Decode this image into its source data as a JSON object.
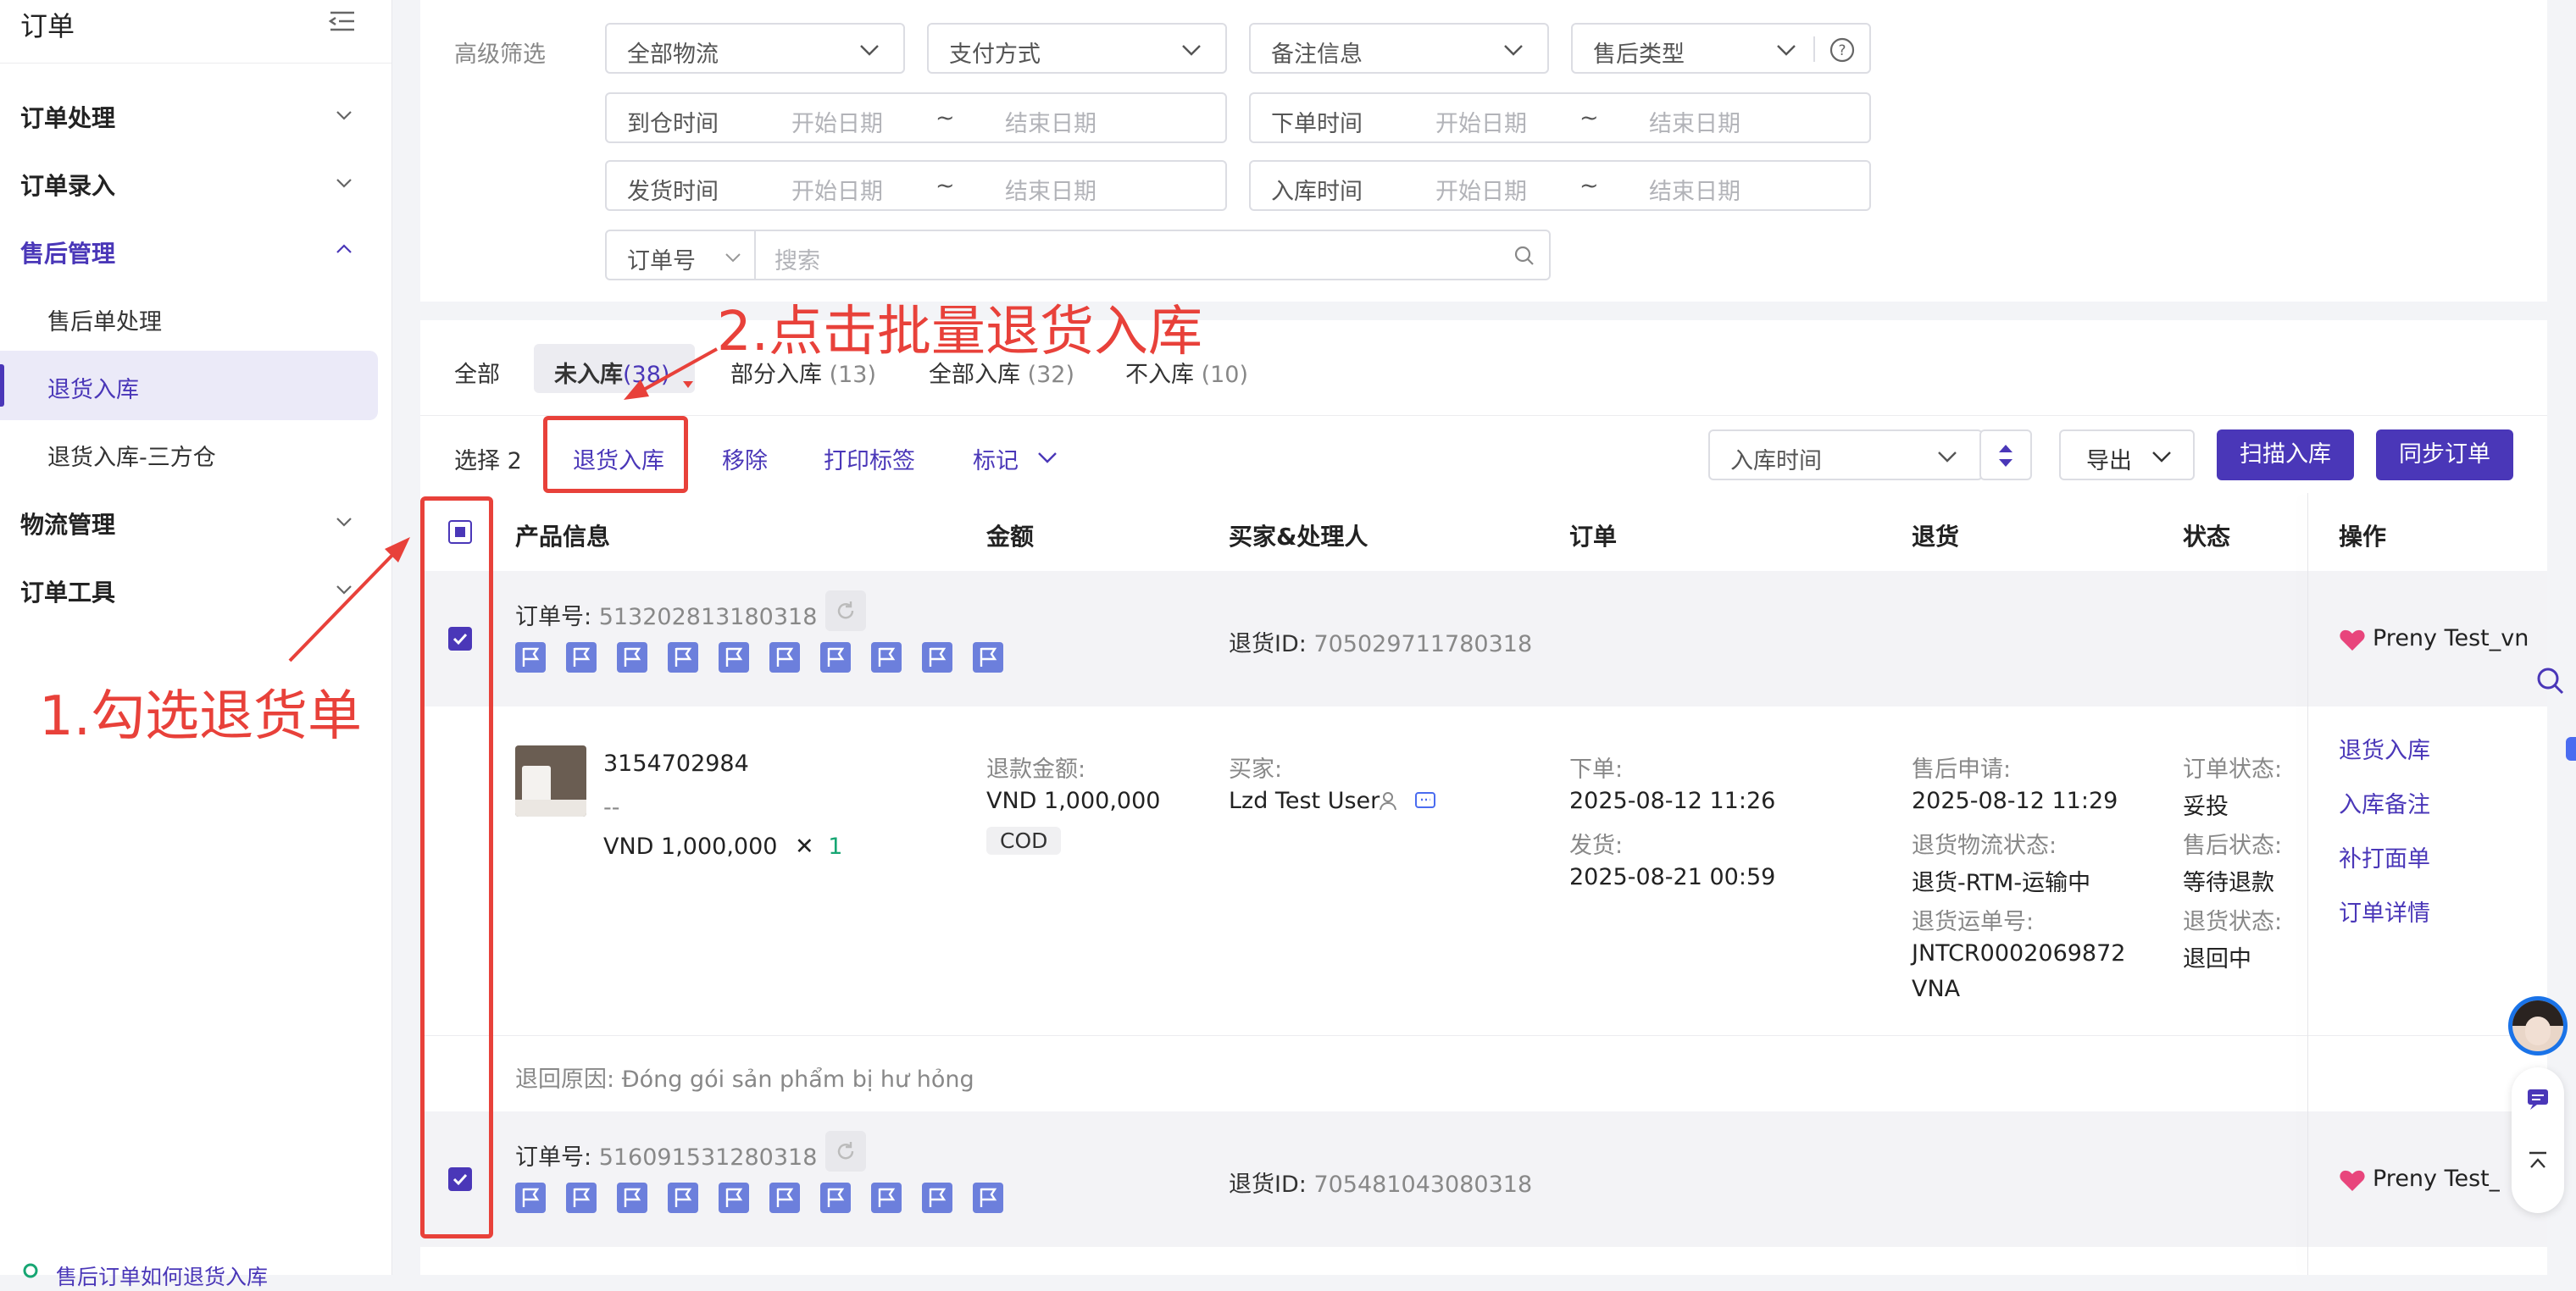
{
  "sidebar": {
    "title": "订单",
    "groups": [
      {
        "label": "订单处理"
      },
      {
        "label": "订单录入"
      },
      {
        "label": "售后管理"
      },
      {
        "label": "物流管理"
      },
      {
        "label": "订单工具"
      }
    ],
    "items": [
      {
        "label": "售后单处理"
      },
      {
        "label": "退货入库"
      },
      {
        "label": "退货入库-三方仓"
      }
    ],
    "help_link": "售后订单如何退货入库"
  },
  "filters": {
    "label": "高级筛选",
    "selects": [
      {
        "value": "全部物流"
      },
      {
        "value": "支付方式"
      },
      {
        "value": "备注信息"
      },
      {
        "value": "售后类型"
      }
    ],
    "date_ranges": [
      {
        "label": "到仓时间",
        "start": "开始日期",
        "end": "结束日期",
        "sep": "~"
      },
      {
        "label": "下单时间",
        "start": "开始日期",
        "end": "结束日期",
        "sep": "~"
      },
      {
        "label": "发货时间",
        "start": "开始日期",
        "end": "结束日期",
        "sep": "~"
      },
      {
        "label": "入库时间",
        "start": "开始日期",
        "end": "结束日期",
        "sep": "~"
      }
    ],
    "search_field": "订单号",
    "search_placeholder": "搜索"
  },
  "tabs": [
    {
      "label": "全部",
      "count": ""
    },
    {
      "label": "未入库",
      "count": "(38)"
    },
    {
      "label": "部分入库",
      "count": "(13)"
    },
    {
      "label": "全部入库",
      "count": "(32)"
    },
    {
      "label": "不入库",
      "count": "(10)"
    }
  ],
  "actions": {
    "selected": "选择 2",
    "return_stock": "退货入库",
    "remove": "移除",
    "print_label": "打印标签",
    "mark": "标记",
    "sort_field": "入库时间",
    "export": "导出",
    "scan_stock": "扫描入库",
    "sync_orders": "同步订单"
  },
  "table": {
    "headers": [
      "产品信息",
      "金额",
      "买家&处理人",
      "订单",
      "退货",
      "状态",
      "操作"
    ],
    "orders": [
      {
        "order_label": "订单号:",
        "order_no": "513202813180318",
        "return_id_label": "退货ID:",
        "return_id": "705029711780318",
        "shop": "Preny Test_vn",
        "product_id": "3154702984",
        "product_dash": "--",
        "product_price": "VND 1,000,000",
        "product_qty_x": "✕",
        "product_qty": "1",
        "refund_label": "退款金额:",
        "refund_amount": "VND 1,000,000",
        "pay_tag": "COD",
        "buyer_label": "买家:",
        "buyer": "Lzd Test User",
        "order_time_label": "下单:",
        "order_time": "2025-08-12 11:26",
        "ship_time_label": "发货:",
        "ship_time": "2025-08-21 00:59",
        "aftersale_apply_label": "售后申请:",
        "aftersale_apply": "2025-08-12 11:29",
        "return_logistics_label": "退货物流状态:",
        "return_logistics": "退货-RTM-运输中",
        "return_waybill_label": "退货运单号:",
        "return_waybill_1": "JNTCR0002069872",
        "return_waybill_2": "VNA",
        "order_status_label": "订单状态:",
        "order_status": "妥投",
        "aftersale_status_label": "售后状态:",
        "aftersale_status": "等待退款",
        "return_status_label": "退货状态:",
        "return_status": "退回中",
        "ops": [
          "退货入库",
          "入库备注",
          "补打面单",
          "订单详情"
        ],
        "reason_label": "退回原因:",
        "reason": "Đóng gói sản phẩm bị hư hỏng"
      },
      {
        "order_label": "订单号:",
        "order_no": "516091531280318",
        "return_id_label": "退货ID:",
        "return_id": "705481043080318",
        "shop": "Preny Test_vn"
      }
    ]
  },
  "annotations": {
    "step1": "1.勾选退货单",
    "step2": "2.点击批量退货入库"
  },
  "colors": {
    "accent": "#4a37b8",
    "annotation": "#e8413a",
    "qty": "#17a673",
    "flag": "#6c7fdc"
  }
}
